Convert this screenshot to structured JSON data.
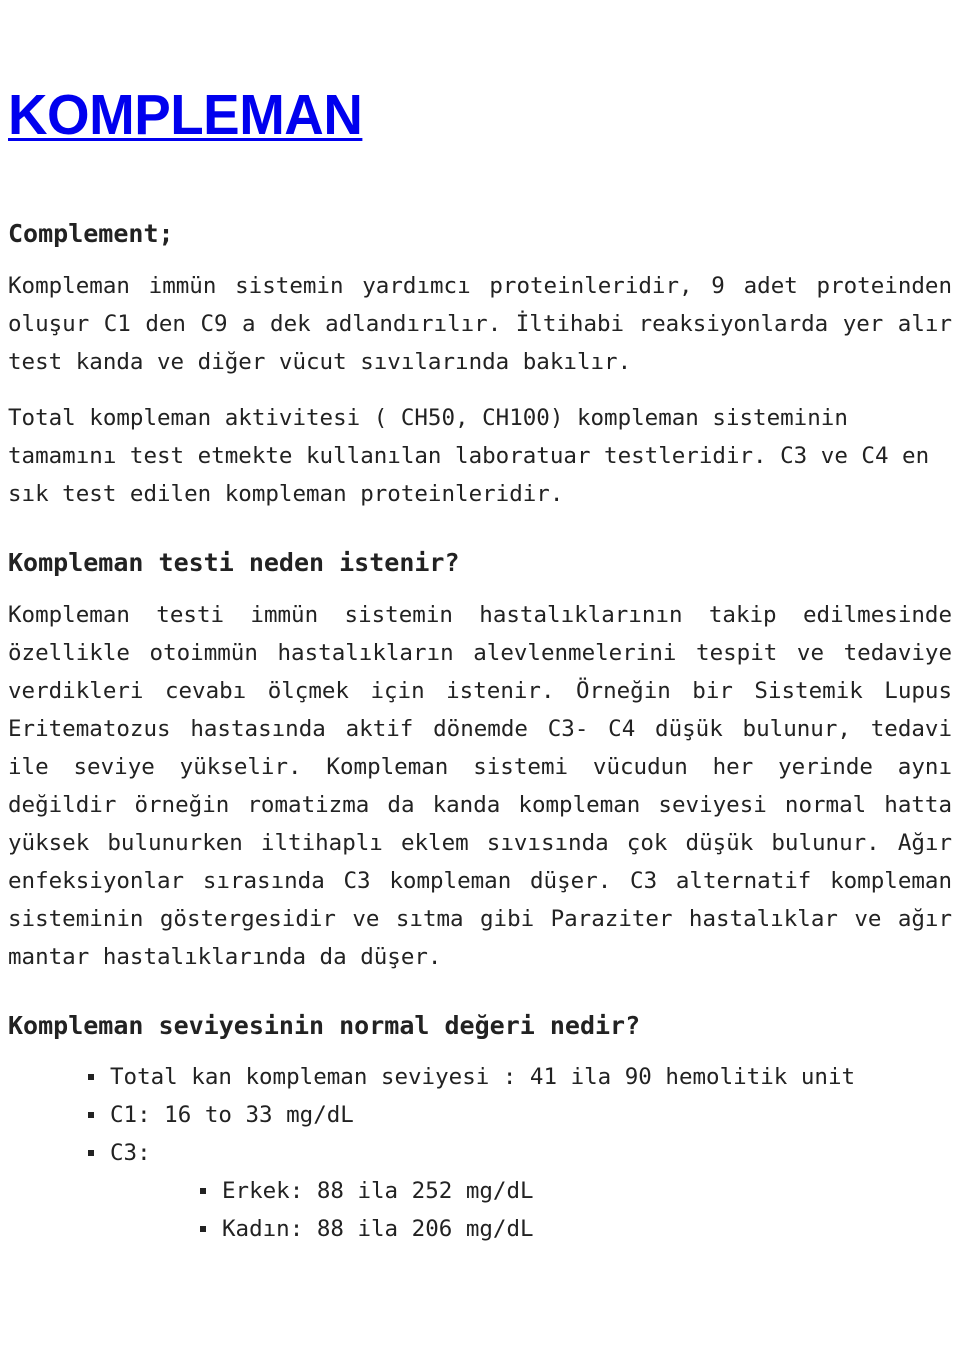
{
  "document": {
    "title_link": "KOMPLEMAN",
    "subtitle": "Complement;",
    "link_color": "#0000ee",
    "text_color": "#222222",
    "background_color": "#ffffff"
  },
  "intro": {
    "paragraph_1": "Kompleman immün sistemin yardımcı proteinleridir, 9 adet proteinden oluşur C1 den C9 a dek adlandırılır. İltihabi reaksiyonlarda yer alır test kanda ve diğer vücut sıvılarında bakılır.",
    "paragraph_2": "Total kompleman aktivitesi ( CH50, CH100) kompleman sisteminin tamamını test etmekte kullanılan laboratuar testleridir. C3 ve C4 en sık test edilen kompleman proteinleridir."
  },
  "section_why": {
    "heading": "Kompleman testi neden istenir?",
    "paragraph_1": "Kompleman testi immün sistemin hastalıklarının takip edilmesinde özellikle otoimmün hastalıkların alevlenmelerini tespit ve tedaviye verdikleri cevabı ölçmek için istenir. Örneğin bir Sistemik Lupus Eritematozus hastasında aktif dönemde C3- C4 düşük bulunur, tedavi ile seviye yükselir. Kompleman sistemi vücudun her yerinde aynı değildir örneğin romatizma da kanda kompleman seviyesi normal hatta yüksek bulunurken iltihaplı eklem sıvısında çok düşük bulunur. Ağır enfeksiyonlar sırasında C3 kompleman düşer. C3 alternatif kompleman sisteminin göstergesidir ve sıtma gibi Paraziter hastalıklar ve ağır mantar hastalıklarında da düşer."
  },
  "section_normal_values": {
    "heading": "Kompleman seviyesinin normal değeri nedir?",
    "items": [
      {
        "text": "Total kan kompleman seviyesi : 41 ila 90 hemolitik unit",
        "children": []
      },
      {
        "text": "C1: 16 to 33 mg/dL",
        "children": []
      },
      {
        "text": "C3:",
        "children": [
          {
            "text": "Erkek: 88 ila 252 mg/dL"
          },
          {
            "text": "Kadın: 88 ila 206 mg/dL"
          }
        ]
      }
    ]
  }
}
